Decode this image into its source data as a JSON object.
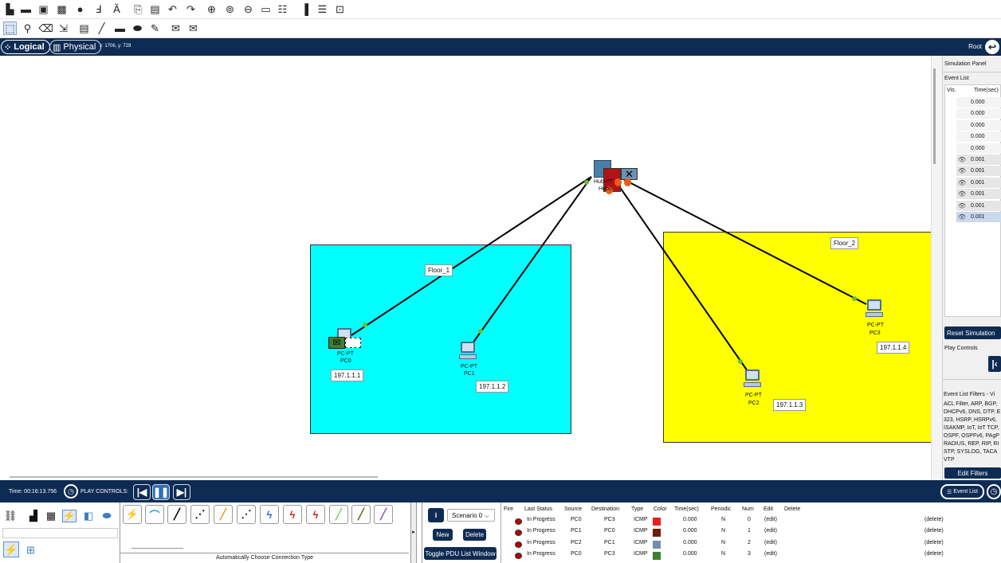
{
  "toolbar1": {
    "icons": [
      "new-file-icon",
      "open-folder-icon",
      "save-icon",
      "print-icon",
      "activity-wizard-icon",
      "tool-icon",
      "text-a-icon",
      "copy-icon",
      "paste-icon",
      "undo-icon",
      "redo-icon",
      "zoom-in-icon",
      "zoom-reset-icon",
      "zoom-out-icon",
      "rectangle-icon",
      "palette-icon",
      "custom-device-icon",
      "cluster-icon",
      "image-icon"
    ]
  },
  "toolbar2": {
    "icons": [
      "select-icon",
      "inspect-icon",
      "delete-icon",
      "resize-icon",
      "note-icon",
      "line-icon",
      "rectangle-icon",
      "ellipse-icon",
      "freeform-icon",
      "add-simple-pdu-icon",
      "add-complex-pdu-icon"
    ]
  },
  "modes": {
    "logical": "Logical",
    "physical": "Physical",
    "coords": "x: 1706, y: 729",
    "root": "Root"
  },
  "canvas": {
    "clusters": [
      {
        "label": "Floor_1",
        "color": "#00ffff"
      },
      {
        "label": "Floor_2",
        "color": "#ffff00"
      }
    ],
    "hub": {
      "type": "Hub-PT",
      "name": "Hub0"
    },
    "devices": [
      {
        "type": "PC-PT",
        "name": "PC0",
        "ip": "197.1.1.1"
      },
      {
        "type": "PC-PT",
        "name": "PC1",
        "ip": "197.1.1.2"
      },
      {
        "type": "PC-PT",
        "name": "PC2",
        "ip": "197.1.1.3"
      },
      {
        "type": "PC-PT",
        "name": "PC3",
        "ip": "197.1.1.4"
      }
    ]
  },
  "sim_panel": {
    "title": "Simulation Panel",
    "event_list": "Event List",
    "col_vis": "Vis.",
    "col_time": "Time(sec)",
    "events": [
      {
        "vis": "",
        "time": "0.000"
      },
      {
        "vis": "",
        "time": "0.000"
      },
      {
        "vis": "",
        "time": "0.000"
      },
      {
        "vis": "",
        "time": "0.000"
      },
      {
        "vis": "",
        "time": "0.000"
      },
      {
        "vis": "eye",
        "time": "0.001"
      },
      {
        "vis": "eye",
        "time": "0.001"
      },
      {
        "vis": "eye",
        "time": "0.001"
      },
      {
        "vis": "eye",
        "time": "0.001"
      },
      {
        "vis": "eye",
        "time": "0.001"
      },
      {
        "vis": "eye",
        "time": "0.001"
      }
    ],
    "reset": "Reset Simulation",
    "play_controls": "Play Controls",
    "filters_title": "Event List Filters - Vi",
    "filters_text": "ACL Filter, ARP, BGP, DHCPv6, DNS, DTP, E 323, HSRP, HSRPv6, ISAKMP, IoT, IoT TCP, OSPF, OSPFv6, PAgP RADIUS, REP, RIP, RI STP, SYSLOG, TACA VTP",
    "edit_filters": "Edit Filters"
  },
  "bottom": {
    "time": "Time: 00:16:13.756",
    "play_controls": "PLAY CONTROLS:",
    "event_list": "Event List",
    "connection_label": "Automatically Choose Connection Type"
  },
  "scenario": {
    "selected": "Scenario 0",
    "new": "New",
    "delete": "Delete",
    "toggle": "Toggle PDU List Window"
  },
  "pdu_table": {
    "headers": [
      "Fire",
      "Last Status",
      "Source",
      "Destination",
      "Type",
      "Color",
      "Time(sec)",
      "Periodic",
      "Num",
      "Edit",
      "Delete"
    ],
    "rows": [
      {
        "status": "In Progress",
        "source": "PC0",
        "dest": "PC3",
        "type": "ICMP",
        "color": "#e8201e",
        "time": "0.000",
        "periodic": "N",
        "num": "0",
        "edit": "(edit)",
        "delete": "(delete)"
      },
      {
        "status": "In Progress",
        "source": "PC1",
        "dest": "PC0",
        "type": "ICMP",
        "color": "#6b1d10",
        "time": "0.000",
        "periodic": "N",
        "num": "1",
        "edit": "(edit)",
        "delete": "(delete)"
      },
      {
        "status": "In Progress",
        "source": "PC2",
        "dest": "PC1",
        "type": "ICMP",
        "color": "#6f8fae",
        "time": "0.000",
        "periodic": "N",
        "num": "2",
        "edit": "(edit)",
        "delete": "(delete)"
      },
      {
        "status": "In Progress",
        "source": "PC0",
        "dest": "PC3",
        "type": "ICMP",
        "color": "#3f7f2f",
        "time": "0.000",
        "periodic": "N",
        "num": "3",
        "edit": "(edit)",
        "delete": "(delete)"
      }
    ]
  }
}
